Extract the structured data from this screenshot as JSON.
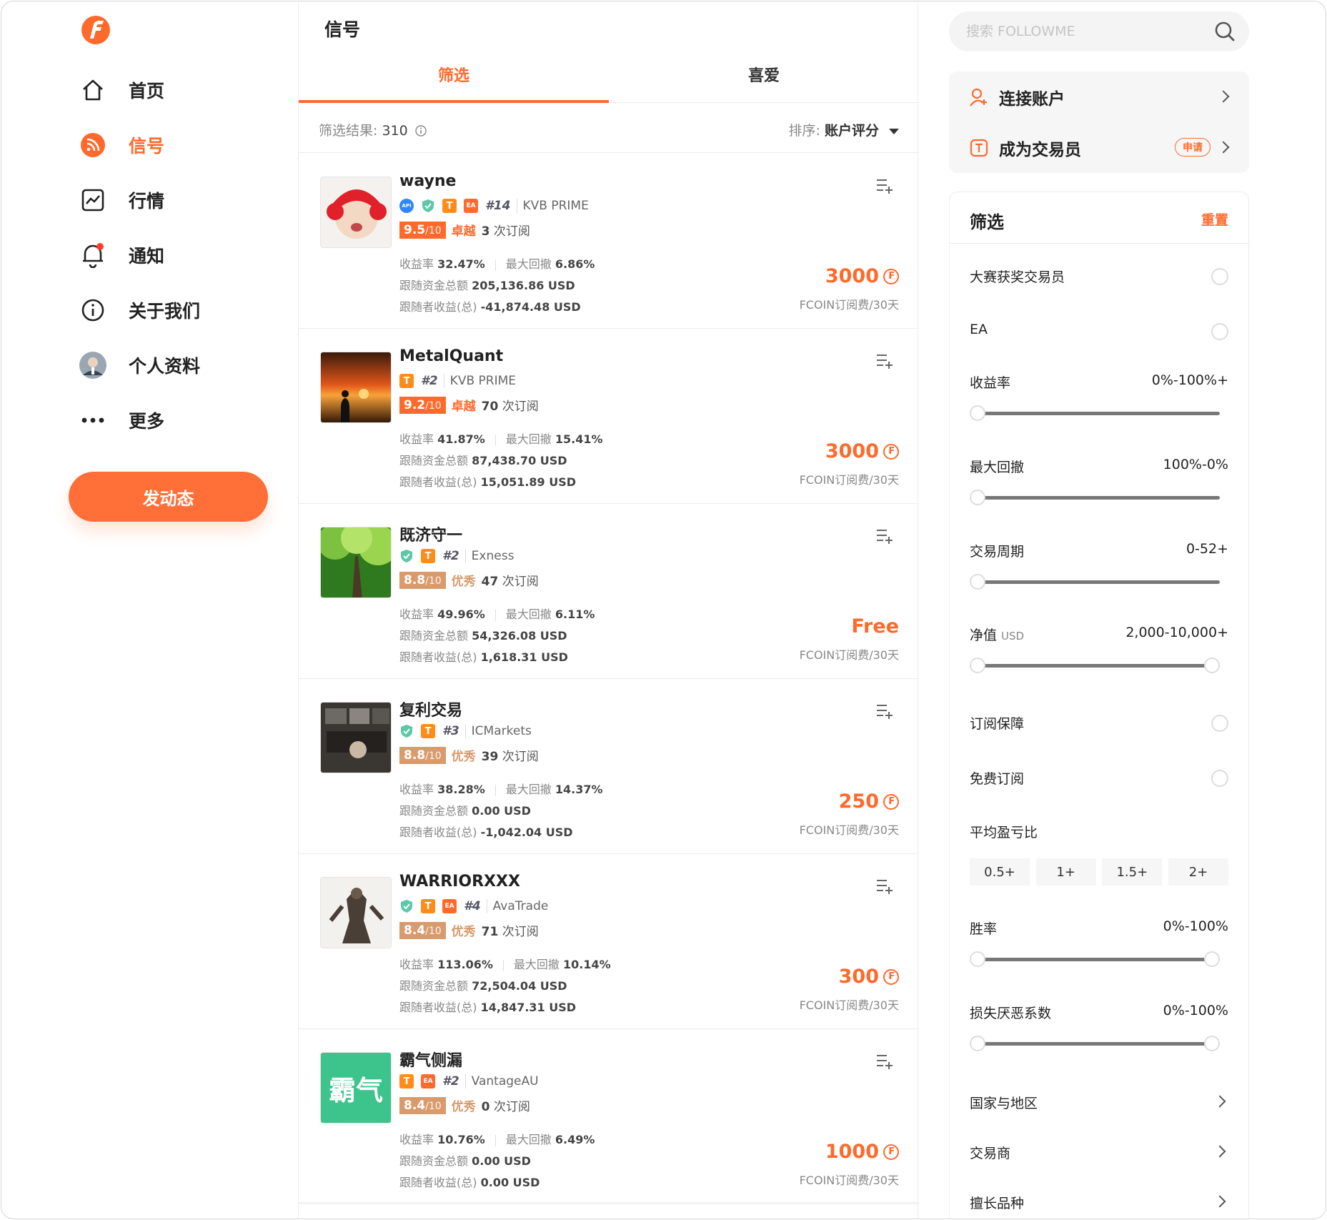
{
  "nav": {
    "items": [
      {
        "label": "首页"
      },
      {
        "label": "信号"
      },
      {
        "label": "行情"
      },
      {
        "label": "通知"
      },
      {
        "label": "关于我们"
      },
      {
        "label": "个人资料"
      },
      {
        "label": "更多"
      }
    ],
    "post_button": "发动态"
  },
  "colors": {
    "accent": "#ff6a2c",
    "excellent": "#ff6a2c",
    "good": "#d99a6c"
  },
  "center": {
    "title": "信号",
    "tabs": [
      {
        "label": "筛选"
      },
      {
        "label": "喜爱"
      }
    ],
    "result_label": "筛选结果:",
    "result_count": "310",
    "sort_label": "排序:",
    "sort_value": "账户评分",
    "labels": {
      "subs_suffix": "次订阅",
      "return": "收益率",
      "drawdown": "最大回撤",
      "funds": "跟随资金总额",
      "profit": "跟随者收益(总)",
      "fee": "FCOIN订阅费/30天"
    },
    "signals": [
      {
        "name": "wayne",
        "rank": "#14",
        "broker": "KVB PRIME",
        "score": "9.5",
        "score_max": "/10",
        "level": "卓越",
        "subs": "3",
        "return": "32.47%",
        "drawdown": "6.86%",
        "funds": "205,136.86 USD",
        "profit": "-41,874.48 USD",
        "price": "3000"
      },
      {
        "name": "MetalQuant",
        "rank": "#2",
        "broker": "KVB PRIME",
        "score": "9.2",
        "score_max": "/10",
        "level": "卓越",
        "subs": "70",
        "return": "41.87%",
        "drawdown": "15.41%",
        "funds": "87,438.70 USD",
        "profit": "15,051.89 USD",
        "price": "3000"
      },
      {
        "name": "既济守一",
        "rank": "#2",
        "broker": "Exness",
        "score": "8.8",
        "score_max": "/10",
        "level": "优秀",
        "subs": "47",
        "return": "49.96%",
        "drawdown": "6.11%",
        "funds": "54,326.08 USD",
        "profit": "1,618.31 USD",
        "price": "Free"
      },
      {
        "name": "复利交易",
        "rank": "#3",
        "broker": "ICMarkets",
        "score": "8.8",
        "score_max": "/10",
        "level": "优秀",
        "subs": "39",
        "return": "38.28%",
        "drawdown": "14.37%",
        "funds": "0.00 USD",
        "profit": "-1,042.04 USD",
        "price": "250"
      },
      {
        "name": "WARRIORXXX",
        "rank": "#4",
        "broker": "AvaTrade",
        "score": "8.4",
        "score_max": "/10",
        "level": "优秀",
        "subs": "71",
        "return": "113.06%",
        "drawdown": "10.14%",
        "funds": "72,504.04 USD",
        "profit": "14,847.31 USD",
        "price": "300"
      },
      {
        "name": "霸气侧漏",
        "avatar_text": "霸气",
        "rank": "#2",
        "broker": "VantageAU",
        "score": "8.4",
        "score_max": "/10",
        "level": "优秀",
        "subs": "0",
        "return": "10.76%",
        "drawdown": "6.49%",
        "funds": "0.00 USD",
        "profit": "0.00 USD",
        "price": "1000"
      }
    ]
  },
  "right": {
    "search_placeholder": "搜索 FOLLOWME",
    "connect_account": "连接账户",
    "become_trader": "成为交易员",
    "apply": "申请",
    "filter": {
      "title": "筛选",
      "reset": "重置",
      "award": "大赛获奖交易员",
      "ea": "EA",
      "return_label": "收益率",
      "return_range": "0%-100%+",
      "drawdown_label": "最大回撤",
      "drawdown_range": "100%-0%",
      "period_label": "交易周期",
      "period_range": "0-52+",
      "equity_label": "净值",
      "equity_unit": "USD",
      "equity_range": "2,000-10,000+",
      "guarantee": "订阅保障",
      "free": "免费订阅",
      "pl_ratio": "平均盈亏比",
      "pl_chips": [
        "0.5+",
        "1+",
        "1.5+",
        "2+"
      ],
      "winrate_label": "胜率",
      "winrate_range": "0%-100%",
      "loss_label": "损失厌恶系数",
      "loss_range": "0%-100%",
      "region": "国家与地区",
      "broker": "交易商",
      "symbols": "擅长品种"
    }
  }
}
